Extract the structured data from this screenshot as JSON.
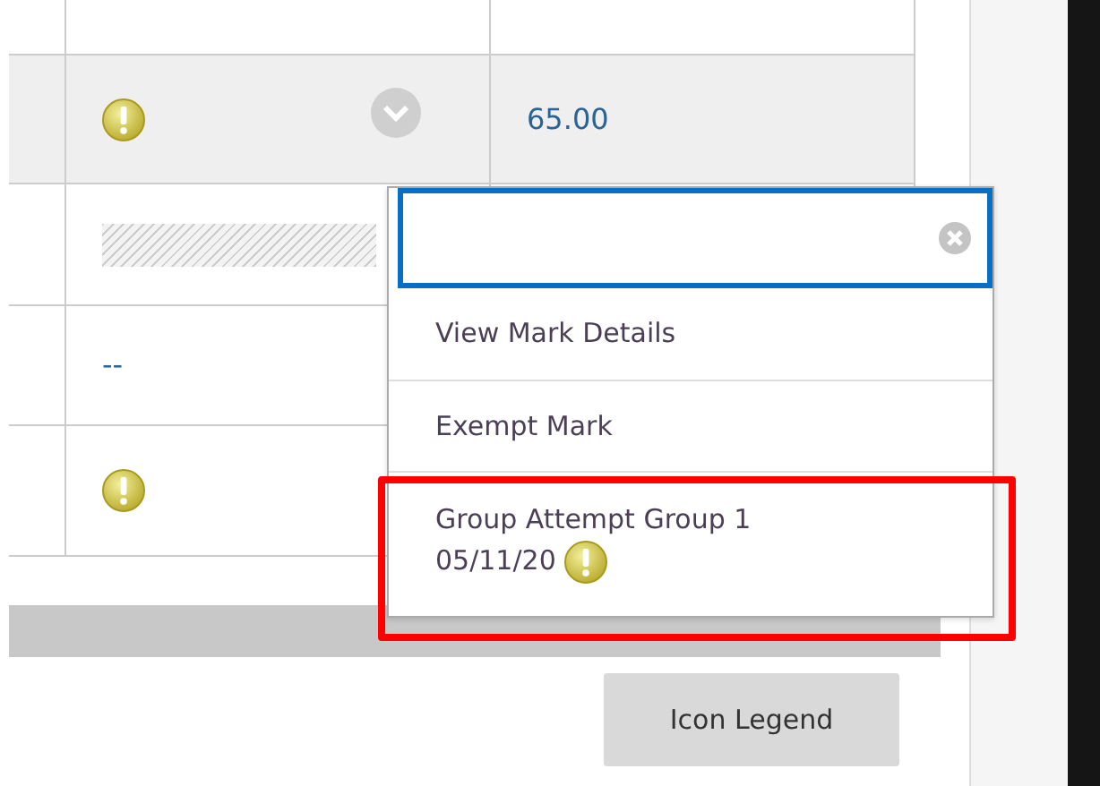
{
  "table": {
    "rows": [
      {
        "shaded": false
      },
      {
        "shaded": true,
        "column_2": {
          "kind": "alert_menu"
        },
        "column_3": {
          "kind": "link",
          "text": "65.00"
        }
      },
      {
        "shaded": false,
        "column_2": {
          "kind": "hatched"
        }
      },
      {
        "shaded": false,
        "column_2": {
          "kind": "link",
          "text": "--"
        }
      },
      {
        "shaded": false,
        "column_2": {
          "kind": "alert"
        }
      }
    ]
  },
  "context_menu": {
    "items": [
      {
        "label": "View Mark Details",
        "highlighted": false,
        "alert": false
      },
      {
        "label": "Exempt Mark",
        "highlighted": false,
        "alert": false
      },
      {
        "label": "Group Attempt Group 1 05/11/20",
        "highlighted": true,
        "alert": true
      }
    ]
  },
  "buttons": [
    {
      "label": "Icon Legend"
    }
  ]
}
